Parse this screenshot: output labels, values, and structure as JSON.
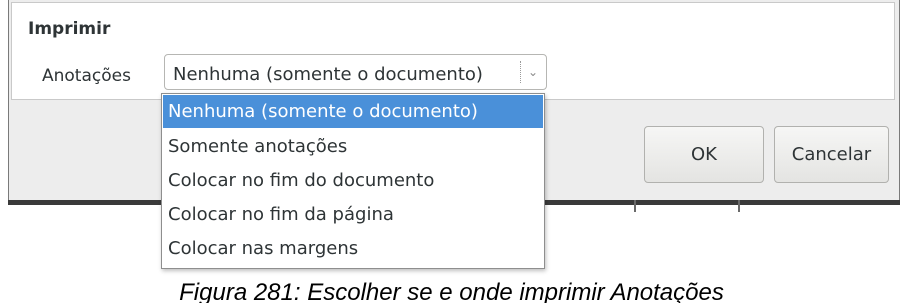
{
  "dialog": {
    "section_title": "Imprimir",
    "annotations_label": "Anotações",
    "annotations_value": "Nenhuma (somente o documento)",
    "ok_label": "OK",
    "cancel_label": "Cancelar"
  },
  "dropdown": {
    "options": [
      "Nenhuma (somente o documento)",
      "Somente anotações",
      "Colocar no fim do documento",
      "Colocar no fim da página",
      "Colocar nas margens"
    ],
    "selected_index": 0
  },
  "caption": "Figura 281: Escolher se e onde imprimir Anotações",
  "colors": {
    "selection": "#4a90d9",
    "dialog_bg": "#ededed"
  }
}
